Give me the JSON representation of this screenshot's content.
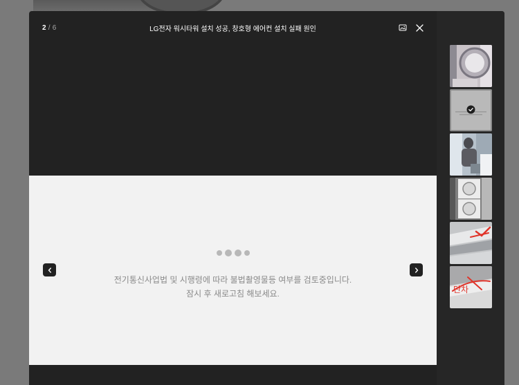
{
  "viewer": {
    "counter": {
      "current": "2",
      "separator": "/",
      "total": "6"
    },
    "title": "LG전자 워시타워 설치 성공, 창호형 에어컨 설치 실패 원인",
    "notice": {
      "line1": "전기통신사업법 및 시행령에 따라 불법촬영물등 여부를 검토중입니다.",
      "line2": "잠시 후 새로고침 해보세요."
    }
  },
  "icons": {
    "original_image": "image-icon",
    "close": "close-icon",
    "prev": "chevron-left-icon",
    "next": "chevron-right-icon",
    "selected": "check-circle-icon"
  },
  "thumbnails": [
    {
      "subject": "drum washer door",
      "selected": false
    },
    {
      "subject": "placeholder under review",
      "selected": true
    },
    {
      "subject": "person installing unit",
      "selected": false
    },
    {
      "subject": "stacked wash tower",
      "selected": false
    },
    {
      "subject": "window frame with red marks",
      "selected": false
    },
    {
      "subject": "sill with red handwriting",
      "selected": false
    }
  ],
  "thumb_handwriting": "단차",
  "colors": {
    "modal": "#222222",
    "panel": "#f2f2f2",
    "notice_text": "#8a8a8a",
    "annotation_red": "#e0342a"
  }
}
